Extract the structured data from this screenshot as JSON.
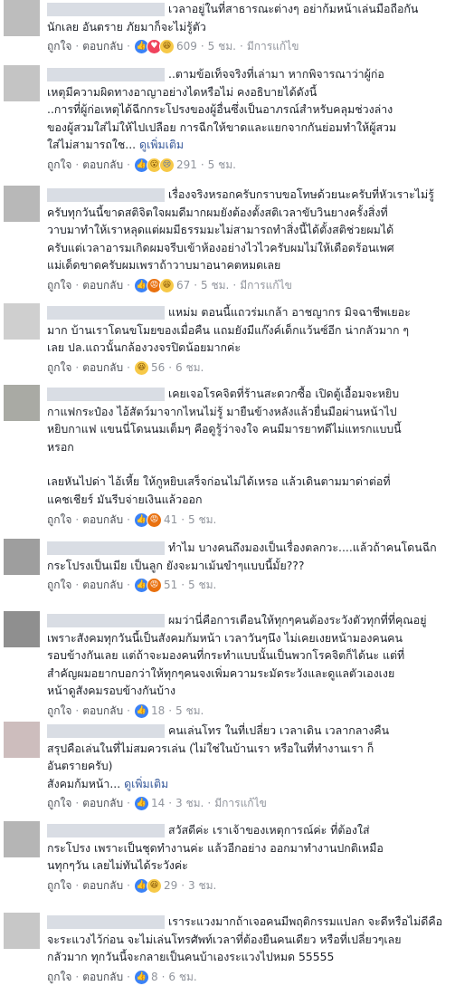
{
  "labels": {
    "like": "ถูกใจ",
    "reply": "ตอบกลับ",
    "edited": "มีการแก้ไข",
    "see_more": "ดูเพิ่มเติม"
  },
  "comments": [
    {
      "lines": [
        "เวลาอยู่ในที่สาธารณะต่างๆ อย่าก้มหน้าเล่นมือถือกัน",
        "นักเลย อันตราย ภัยมาก็จะไม่รู้ตัว"
      ],
      "count": "609",
      "time": "5 ชม.",
      "edited": true,
      "reactions": [
        "like-icon",
        "love-icon",
        "haha-icon"
      ]
    },
    {
      "lines": [
        "..ตามข้อเท็จจริงที่เล่ามา หากพิจารณาว่าผู้ก่อ",
        "เหตุมีความผิดทางอาญาอย่างไดหรือไม่ คงอธิบายได้ดังนี้",
        "..การที่ผู้ก่อเหตุได้ฉีกกระโปรงของผู้อื่นซึ่งเป็นอาภรณ์สำหรับคลุมช่วงล่าง",
        "ของผู้สวมใส่ไม่ให้ไปเปลือย การฉีกให้ขาดและแยกจากกันย่อมทำให้ผู้สวม",
        "ใส่ไม่สามารถใช..."
      ],
      "see_more": true,
      "count": "291",
      "time": "5 ชม.",
      "edited": false,
      "reactions": [
        "like-icon",
        "wow-icon",
        "sad-icon"
      ]
    },
    {
      "lines": [
        "เรื่องจริงหรอกครับกราบขอโทษด้วยนะครับที่หัวเราะไม่รู้",
        "ครับทุกวันนี้ขาดสติจิตใจผมดีมากผมยังต้องตั้งสติเวลาขับวินยางครั้งสิ่งที่",
        "วาบมาทำให้เราหลุดแต่ผมมีธรรมมะไม่สามารถทำสิ่งนี้ได้ตั้งสติช่วยผมได้",
        "ครับแต่เวลาอารมเกิดผมจรีบเข้าห้องอย่างไวไวครับผมไม่ให้เดือดร้อนเพศ",
        "แม่เด็ดขาดครับผมเพราถ้าวาบมาอนาคตหมดเลย"
      ],
      "count": "67",
      "time": "5 ชม.",
      "edited": true,
      "reactions": [
        "like-icon",
        "angry-icon",
        "haha-icon"
      ]
    },
    {
      "lines": [
        "แหม่ม ตอนนี้แถวร่มเกล้า อาชญากร มิจฉาชีพเยอะ",
        "มาก บ้านเราโดนขโมยของเมื่อคืน แถมยังมีแก๊งค์เด็กแว้นซ์อีก น่ากลัวมาก ๆ",
        "เลย ปล.แถวนั้นกล้องวงจรปิดน้อยมากค่ะ"
      ],
      "count": "56",
      "time": "6 ชม.",
      "edited": false,
      "reactions": [
        "haha-icon"
      ]
    },
    {
      "lines": [
        "เคยเจอโรคจิตที่ร้านสะดวกซื้อ เปิดตู้เอื้อมจะหยิบ",
        "กาแฟกระป๋อง ไอ้สัตว์มาจากไหนไม่รู้ มายืนข้างหลังแล้วยื่นมือผ่านหน้าไป",
        "หยิบกาแฟ แขนนี่โดนนมเต็มๆ คือดูรู้ว่าจงใจ คนมีมารยาทดีไม่แทรกแบบนี้",
        "หรอก"
      ],
      "lines2": [
        "เลยหันไปด่า ไอ้เหี้ย ให้กูหยิบเสร็จก่อนไม่ได้เหรอ แล้วเดินตามมาด่าต่อที่",
        "แคชเชียร์ มันรีบจ่ายเงินแล้วออก"
      ],
      "count": "41",
      "time": "5 ชม.",
      "edited": false,
      "reactions": [
        "like-icon",
        "angry-icon"
      ]
    },
    {
      "lines": [
        "ทำไม บางคนถึงมองเป็นเรื่องตลกวะ....แล้วถ้าคนโดนฉีก",
        "กระโปรงเป็นเมีย เป็นลูก ยังจะมาเม้นขำๆแบบนี้มั้ย???"
      ],
      "count": "51",
      "time": "5 ชม.",
      "edited": false,
      "reactions": [
        "like-icon",
        "angry-icon"
      ]
    },
    {
      "lines": [
        "ผมว่านี่คือการเตือนให้ทุกๆคนต้องระวังตัวทุกที่ที่คุณอยู่",
        "เพราะสังคมทุกวันนี้เป็นสังคมก้มหน้า เวลาวันๆนึง ไม่เคยเงยหน้ามองคนคน",
        "รอบข้างกันเลย แต่ถ้าจะมองคนที่กระทำแบบนั้นเป็นพวกโรคจิตก็ได้นะ แต่ที่",
        "สำคัญผมอยากบอกว่าให้ทุกๆคนจงเพิ่มความระมัดระวังและดูแลตัวเองเงย",
        "หน้าดูสังคมรอบข้างกันบ้าง"
      ],
      "count": "18",
      "time": "5 ชม.",
      "edited": false,
      "reactions": [
        "like-icon"
      ]
    },
    {
      "lines": [
        "คนเล่นโทร ในที่เปลี่ยว เวลาเดิน เวลากลางคืน",
        "สรุปคือเล่นในที่ไม่สมควรเล่น (ไม่ใช่ในบ้านเรา หรือในที่ทำงานเรา ก็",
        "อันตรายครับ)",
        "สังคมก้มหน้า..."
      ],
      "see_more": true,
      "count": "14",
      "time": "3 ชม.",
      "edited": true,
      "reactions": [
        "like-icon"
      ]
    },
    {
      "lines": [
        "สวัสดีค่ะ เราเจ้าของเหตุการณ์ค่ะ ที่ต้องใส่",
        "กระโปรง เพราะเป็นชุดทำงานค่ะ แล้วอีกอย่าง ออกมาทำงานปกติเหมือ",
        "นทุกๆวัน เลยไม่ทันได้ระวังค่ะ"
      ],
      "count": "29",
      "time": "3 ชม.",
      "edited": false,
      "reactions": [
        "like-icon",
        "haha-icon"
      ]
    },
    {
      "lines": [
        "เราระแวงมากถ้าเจอคนมีพฤติกรรมแปลก จะดีหรือไม่ดีคือ",
        "จะระแวงไว้ก่อน จะไม่เล่นโทรศัพท์เวลาที่ต้องยืนคนเดียว หรือที่เปลี่ยวๆเลย",
        "กลัวมาก ทุกวันนี้จะกลายเป็นคนบ้าเองระแวงไปหมด 55555"
      ],
      "count": "8",
      "time": "6 ชม.",
      "edited": false,
      "reactions": [
        "like-icon"
      ]
    }
  ]
}
